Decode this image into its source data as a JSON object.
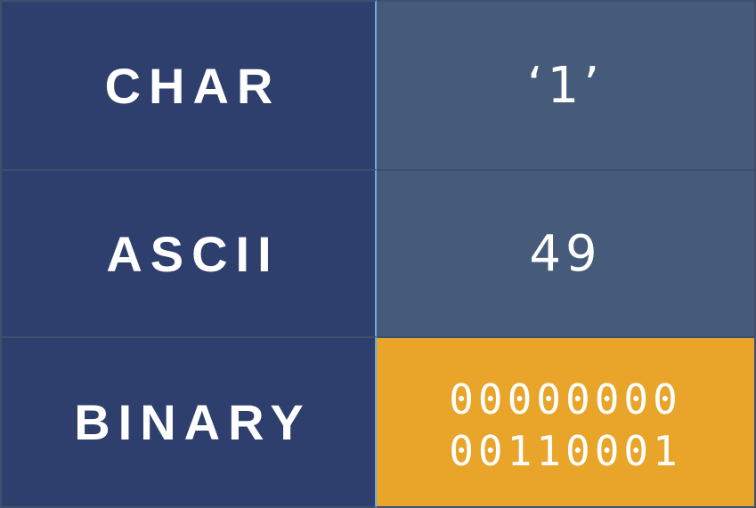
{
  "rows": [
    {
      "label": "CHAR",
      "value": "‘1’"
    },
    {
      "label": "ASCII",
      "value": "49"
    },
    {
      "label": "BINARY",
      "value_lines": [
        "00000000",
        "00110001"
      ]
    }
  ],
  "colors": {
    "label_bg": "#2e3f6e",
    "value_bg": "#465a7a",
    "highlight_bg": "#e8a52a",
    "text": "#ffffff"
  }
}
